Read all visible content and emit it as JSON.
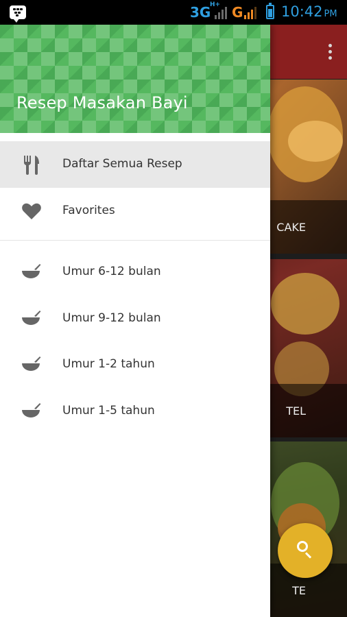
{
  "status_bar": {
    "network_3g": "3G",
    "network_hplus": "H+",
    "network_g": "G",
    "time": "10:42",
    "ampm": "PM",
    "colors": {
      "network_blue": "#2f9fe0",
      "carrier_orange": "#f08a24"
    }
  },
  "app": {
    "toolbar_color": "#8a1f1f",
    "cards": [
      {
        "caption": "CAKE"
      },
      {
        "caption": "TEL"
      },
      {
        "caption": "TE"
      }
    ],
    "fab_color": "#e3b128"
  },
  "drawer": {
    "title": "Resep Masakan Bayi",
    "header_color": "#55b85f",
    "items": [
      {
        "label": "Daftar Semua Resep",
        "icon": "fork-knife-icon",
        "active": true
      },
      {
        "label": "Favorites",
        "icon": "heart-icon",
        "active": false
      }
    ],
    "categories": [
      {
        "label": "Umur 6-12 bulan",
        "icon": "bowl-icon"
      },
      {
        "label": "Umur 9-12 bulan",
        "icon": "bowl-icon"
      },
      {
        "label": "Umur 1-2 tahun",
        "icon": "bowl-icon"
      },
      {
        "label": "Umur 1-5 tahun",
        "icon": "bowl-icon"
      }
    ]
  }
}
